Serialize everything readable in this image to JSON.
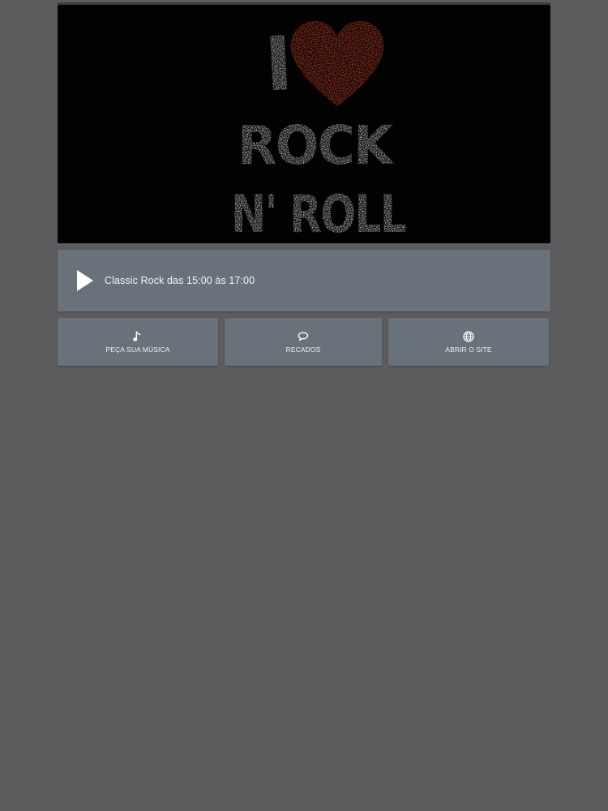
{
  "banner": {
    "logo_text": [
      "I",
      "ROCK",
      "N' ROLL"
    ],
    "heart_color": "#e2492f",
    "text_color": "#e9e9e9"
  },
  "player": {
    "now_playing": "Classic Rock das 15:00 às 17:00",
    "play_icon": "play-icon"
  },
  "actions": [
    {
      "label": "PEÇA SUA MÚSICA",
      "icon": "music-note-icon"
    },
    {
      "label": "RECADOS",
      "icon": "speech-bubble-icon"
    },
    {
      "label": "ABRIR O SITE",
      "icon": "globe-icon"
    }
  ],
  "colors": {
    "background": "#5d5c5e",
    "card": "#69717a",
    "banner_bg": "#020202"
  }
}
